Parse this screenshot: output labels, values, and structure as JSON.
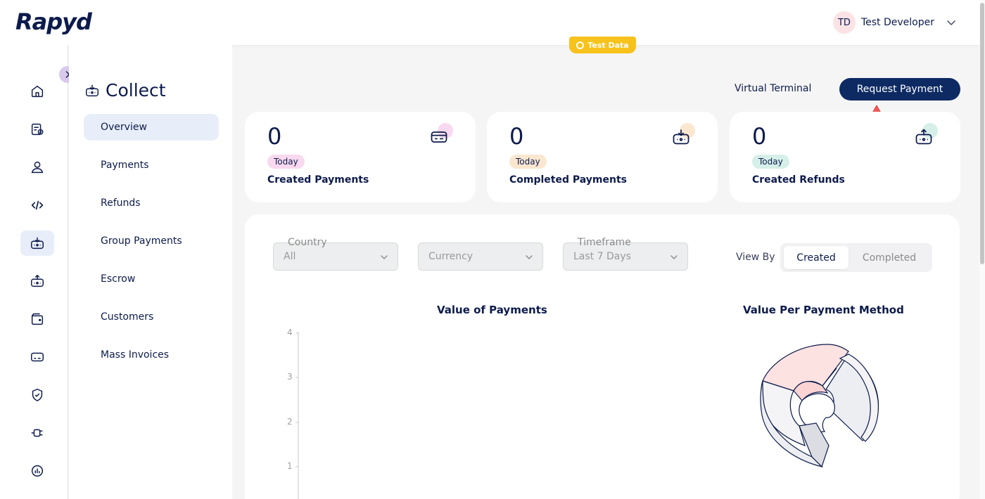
{
  "header": {
    "logo": "Rapyd",
    "user": {
      "initials": "TD",
      "name": "Test Developer"
    },
    "test_badge": "Test Data"
  },
  "icon_rail": {
    "items": [
      "home-icon",
      "invoice-icon",
      "user-icon",
      "code-icon",
      "collect-icon",
      "disburse-icon",
      "wallet-icon",
      "card-icon",
      "shield-icon",
      "plug-icon",
      "report-icon"
    ],
    "active": "collect-icon"
  },
  "page": {
    "title": "Collect",
    "virtual_terminal": "Virtual Terminal",
    "request_payment": "Request Payment"
  },
  "subnav": {
    "items": [
      "Overview",
      "Payments",
      "Refunds",
      "Group Payments",
      "Escrow",
      "Customers",
      "Mass Invoices"
    ],
    "active": "Overview"
  },
  "cards": [
    {
      "value": "0",
      "period": "Today",
      "label": "Created Payments",
      "accent": "#f9d9ef",
      "icon": "card-icon"
    },
    {
      "value": "0",
      "period": "Today",
      "label": "Completed Payments",
      "accent": "#fbe6d0",
      "icon": "collect-icon"
    },
    {
      "value": "0",
      "period": "Today",
      "label": "Created Refunds",
      "accent": "#d6efe9",
      "icon": "refund-icon"
    }
  ],
  "filters": {
    "country": {
      "label": "Country",
      "value": "All"
    },
    "currency": {
      "label": "",
      "value": "Currency"
    },
    "timeframe": {
      "label": "Timeframe",
      "value": "Last 7 Days"
    }
  },
  "view_by": {
    "label": "View By",
    "options": [
      "Created",
      "Completed"
    ],
    "selected": "Created"
  },
  "charts": {
    "payments_title": "Value of Payments",
    "method_title": "Value Per Payment Method"
  },
  "chart_data": {
    "type": "line",
    "title": "Value of Payments",
    "y_ticks": [
      "4",
      "3",
      "2",
      "1"
    ],
    "ylim": [
      0,
      4
    ]
  },
  "colors": {
    "primary": "#0d2a63",
    "accent_yellow": "#f7c21b",
    "active_bg": "#e8eef9"
  }
}
